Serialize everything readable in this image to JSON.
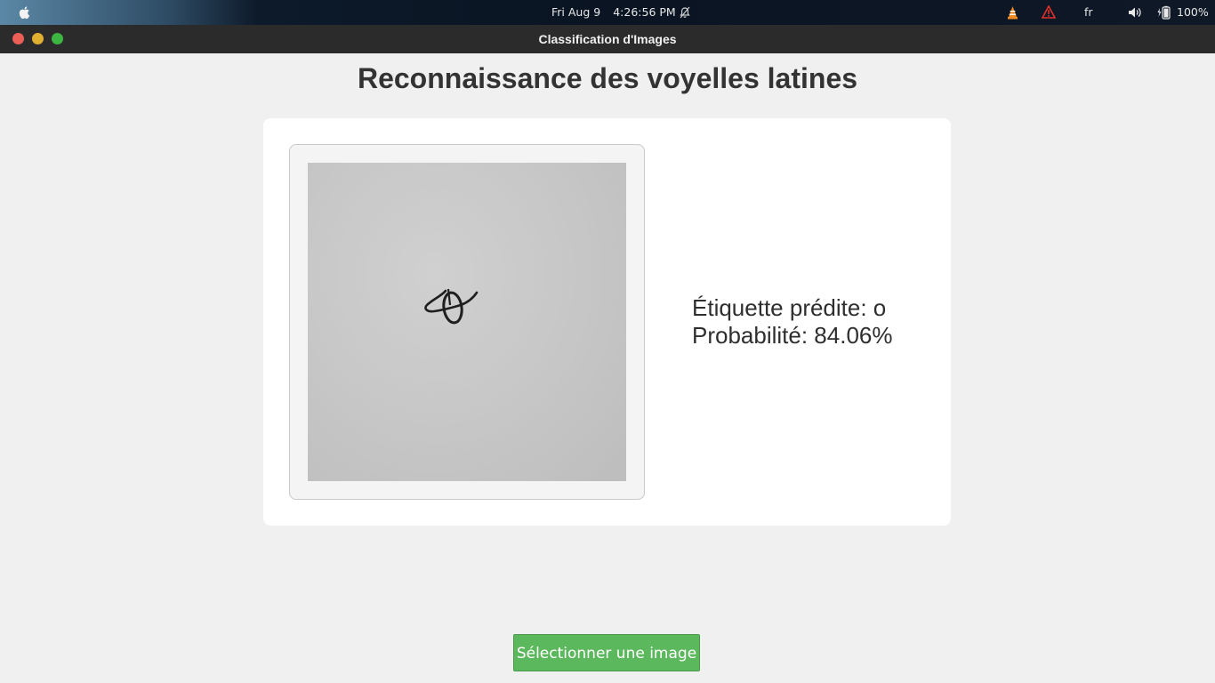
{
  "system_bar": {
    "date": "Fri Aug 9",
    "time": "4:26:56 PM",
    "language": "fr",
    "battery": "100%",
    "icons": [
      "apple-icon",
      "bell-muted-icon",
      "vlc-icon",
      "warning-icon",
      "volume-icon",
      "battery-icon"
    ]
  },
  "window": {
    "title": "Classification d'Images",
    "controls": [
      "close",
      "minimize",
      "maximize"
    ]
  },
  "main": {
    "heading": "Reconnaissance des voyelles latines",
    "prediction_label": "Étiquette prédite: o",
    "probability_label": "Probabilité: 84.06%",
    "select_button": "Sélectionner une image"
  },
  "colors": {
    "button_green": "#5cb85c",
    "close_red": "#ec5f57",
    "minimize_yellow": "#e0b030",
    "maximize_green": "#3db541"
  }
}
